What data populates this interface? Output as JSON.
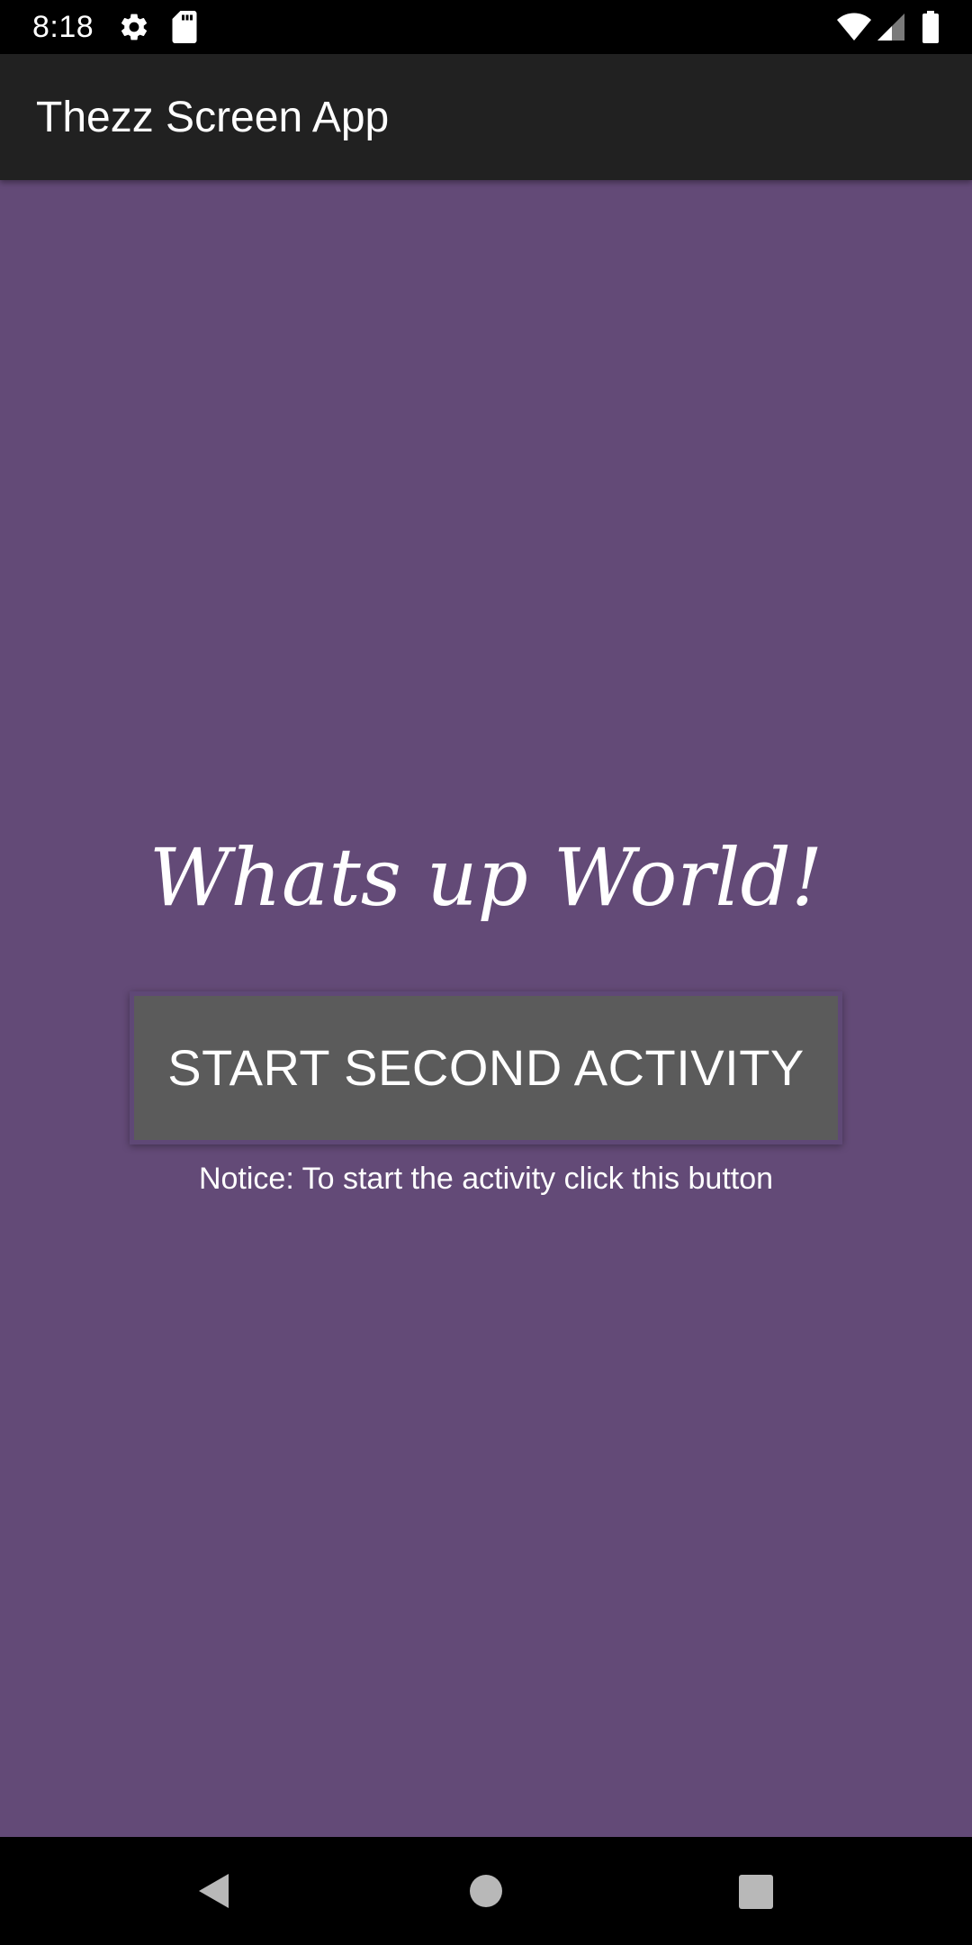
{
  "status_bar": {
    "time": "8:18",
    "icons": [
      "gear-icon",
      "sd-card-icon",
      "wifi-icon",
      "signal-icon",
      "battery-icon"
    ]
  },
  "app_bar": {
    "title": "Thezz Screen App"
  },
  "main": {
    "headline": "Whats up World!",
    "button_label": "START SECOND ACTIVITY",
    "notice": "Notice: To start the activity click this button"
  },
  "nav_bar": {
    "icons": [
      "back-icon",
      "home-icon",
      "recents-icon"
    ]
  },
  "colors": {
    "background": "#634a77",
    "app_bar": "#212121",
    "button": "#5b5b5b",
    "status_bar": "#000000",
    "nav_icons": "#b8b8b8"
  }
}
